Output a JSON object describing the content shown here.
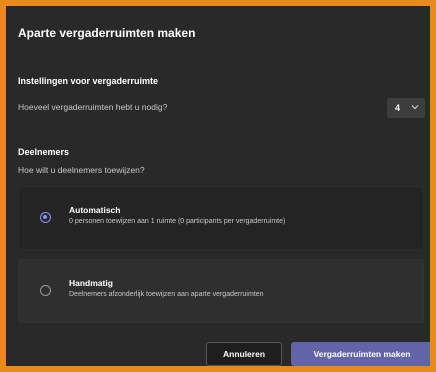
{
  "dialog": {
    "title": "Aparte vergaderruimten maken"
  },
  "settings": {
    "heading": "Instellingen voor vergaderruimte",
    "rooms_question": "Hoeveel vergaderruimten hebt u nodig?",
    "rooms_value": "4"
  },
  "participants": {
    "heading": "Deelnemers",
    "question": "Hoe wilt u deelnemers toewijzen?",
    "options": [
      {
        "label": "Automatisch",
        "description": "0 personen toewijzen aan 1 ruimte (0 participants per vergaderruimte)",
        "selected": true
      },
      {
        "label": "Handmatig",
        "description": "Deelnemers afzonderlijk toewijzen aan aparte vergaderruimten",
        "selected": false
      }
    ]
  },
  "footer": {
    "cancel_label": "Annuleren",
    "create_label": "Vergaderruimten maken"
  },
  "colors": {
    "accent": "#6264a7",
    "radio_selected": "#8c8ff5",
    "frame_border": "#e8891c",
    "background": "#292929"
  }
}
